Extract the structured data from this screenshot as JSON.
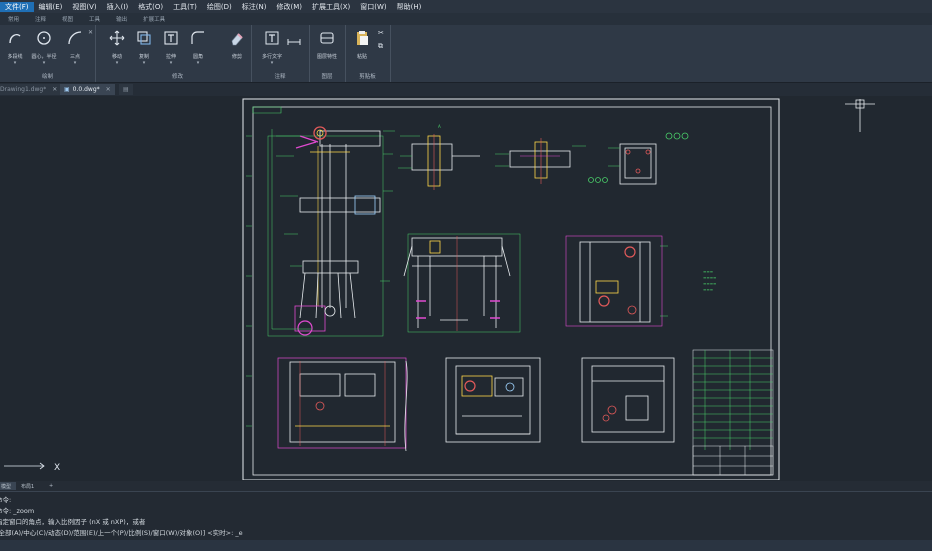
{
  "menu": [
    "文件(F)",
    "编辑(E)",
    "视图(V)",
    "插入(I)",
    "格式(O)",
    "工具(T)",
    "绘图(D)",
    "标注(N)",
    "修改(M)",
    "扩展工具(X)",
    "窗口(W)",
    "帮助(H)"
  ],
  "ribbon_tabs": [
    "常用",
    "注释",
    "视图",
    "工具",
    "输出",
    "扩展工具"
  ],
  "ribbon": {
    "draw": {
      "label": "绘制",
      "polyline": "多段线",
      "circle": "圆心，半径",
      "arc": "三点"
    },
    "modify": {
      "label": "修改",
      "move": "移动",
      "copy": "复制",
      "stretch": "拉伸",
      "fillet": "圆角",
      "erase": "修剪"
    },
    "annotate": {
      "label": "注释",
      "mtext": "多行文字"
    },
    "layers": {
      "label": "图层",
      "props": "图层特性"
    },
    "clipboard": {
      "label": "剪贴板",
      "paste": "粘贴"
    }
  },
  "doc_tabs": {
    "tab1": "Drawing1.dwg*",
    "tab2": "0.0.dwg*"
  },
  "layout_tabs": [
    "模型",
    "布局1"
  ],
  "command_lines": [
    "命令:",
    "命令: _zoom",
    "指定窗口的角点，输入比例因子 (nX 或 nXP)，或者",
    "[全部(A)/中心(C)/动态(D)/范围(E)/上一个(P)/比例(S)/窗口(W)/对象(O)] <实时>: _e"
  ],
  "ucs": {
    "x_label": "X"
  },
  "colors": {
    "accent": "#1f6fb5",
    "canvas": "#212830",
    "ribbon": "#2f3946"
  }
}
